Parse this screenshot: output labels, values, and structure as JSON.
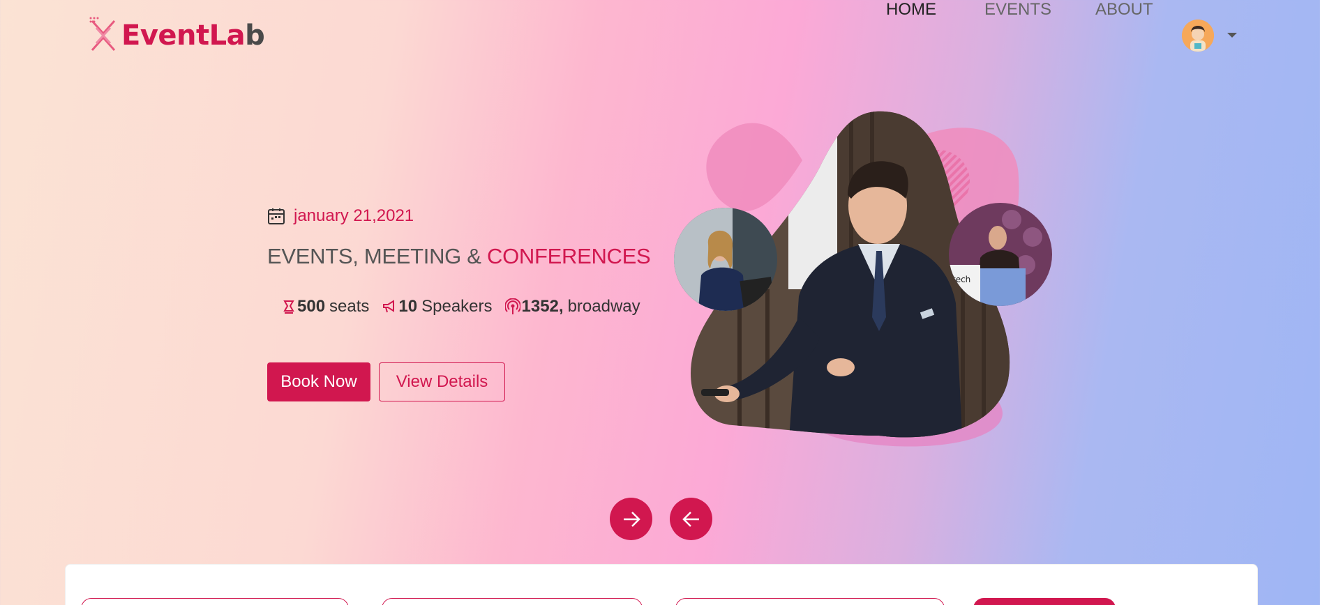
{
  "brand": {
    "name_part1": "Event",
    "name_part2": "La",
    "name_part3": "b"
  },
  "nav": {
    "items": [
      {
        "label": "HOME",
        "active": true
      },
      {
        "label": "EVENTS",
        "active": false
      },
      {
        "label": "ABOUT",
        "active": false
      }
    ]
  },
  "hero": {
    "date": "january 21,2021",
    "headline_main": "EVENTS, MEETING & ",
    "headline_accent": "CONFERENCES",
    "stats": [
      {
        "icon": "seat-icon",
        "value": "500",
        "label": "seats"
      },
      {
        "icon": "megaphone-icon",
        "value": "10",
        "label": "Speakers"
      },
      {
        "icon": "broadcast-icon",
        "value": "1352,",
        "label": "broadway"
      }
    ],
    "book_label": "Book Now",
    "details_label": "View Details"
  },
  "colors": {
    "accent": "#d1174f",
    "text": "#555555"
  }
}
